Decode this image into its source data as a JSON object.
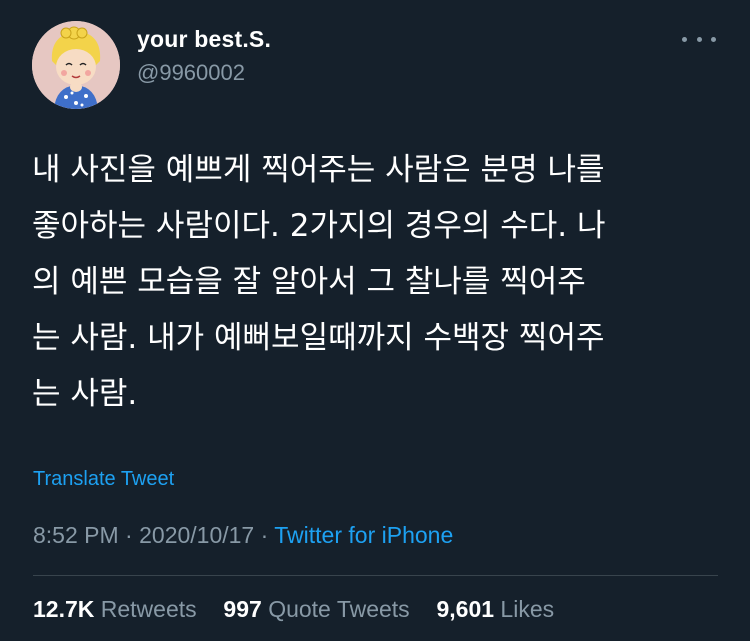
{
  "user": {
    "name": "your best.S.",
    "handle": "@9960002"
  },
  "tweet": {
    "text": "내 사진을 예쁘게 찍어주는 사람은 분명 나를\n좋아하는 사람이다. 2가지의 경우의 수다. 나\n의 예쁜 모습을 잘 알아서 그 찰나를 찍어주\n는 사람. 내가 예뻐보일때까지 수백장 찍어주\n는 사람.",
    "translate_label": "Translate Tweet"
  },
  "meta": {
    "time": "8:52 PM",
    "date": "2020/10/17",
    "separator": "·",
    "source": "Twitter for iPhone"
  },
  "stats": {
    "retweets_count": "12.7K",
    "retweets_label": "Retweets",
    "quotes_count": "997",
    "quotes_label": "Quote Tweets",
    "likes_count": "9,601",
    "likes_label": "Likes"
  },
  "icons": {
    "more": "more-horizontal-icon",
    "avatar": "cartoon-avatar"
  },
  "colors": {
    "background": "#15202b",
    "text": "#ffffff",
    "secondary": "#8899a6",
    "accent": "#1da1f2",
    "divider": "#38444d"
  }
}
